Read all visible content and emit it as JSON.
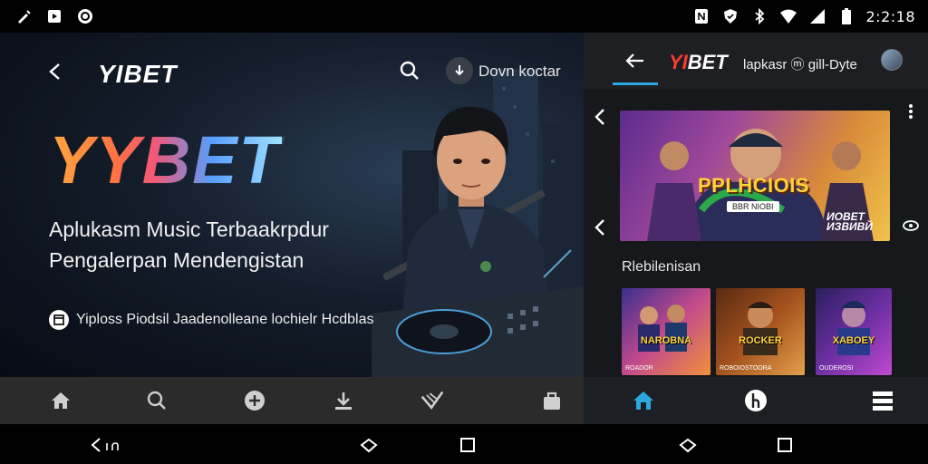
{
  "status_bar": {
    "left_icons": [
      "pen-icon",
      "play-box-icon",
      "shield-circle-icon"
    ],
    "right_icons": [
      "nfc-icon",
      "shield-icon",
      "bluetooth-icon",
      "wifi-icon",
      "signal-icon",
      "battery-icon"
    ],
    "time": "2:2:18"
  },
  "left": {
    "logo": "YIBET",
    "download_label": "Dovn koctar",
    "hero_logo": "YYBET",
    "headline_line1": "Aplukasm Music Terbaakrpdur",
    "headline_line2": "Pengalerpan Mendengistan",
    "feature_text": "Yiploss Piodsil Jaadenolleane lochielr Hcdblas",
    "nav": [
      "home-icon",
      "search-icon",
      "plus-circle-icon",
      "download-icon",
      "check-badge-icon",
      "bag-icon"
    ]
  },
  "right": {
    "logo_red": "YI",
    "logo_white": "BET",
    "app_label": "lapkasr ⓜ gill-Dyte",
    "banner_title": "PPLHCIOIS",
    "banner_sub": "BBR NIOBI",
    "banner_side": "ИОВЕТ\nИЗВИВЙ",
    "section_title": "Rlebilenisan",
    "thumbs": [
      {
        "title": "NAROBNA",
        "caption": "ROADOR",
        "colors": [
          "#3a2f8f",
          "#c24a8c",
          "#f0913a"
        ]
      },
      {
        "title": "ROCKER",
        "caption": "ROBOIOSTOORA",
        "colors": [
          "#5a2a12",
          "#a4521e",
          "#e3a04a"
        ]
      },
      {
        "title": "XABOEY",
        "caption": "OUDEROSI",
        "colors": [
          "#2b1f5e",
          "#6a2fa1",
          "#c04ad0"
        ]
      }
    ],
    "nav": [
      "home-icon",
      "download-circle-icon",
      "menu-icon"
    ]
  },
  "colors": {
    "accent": "#2aa8e0",
    "logo_red": "#ff3b2f",
    "banner_title": "#ffd23a"
  }
}
